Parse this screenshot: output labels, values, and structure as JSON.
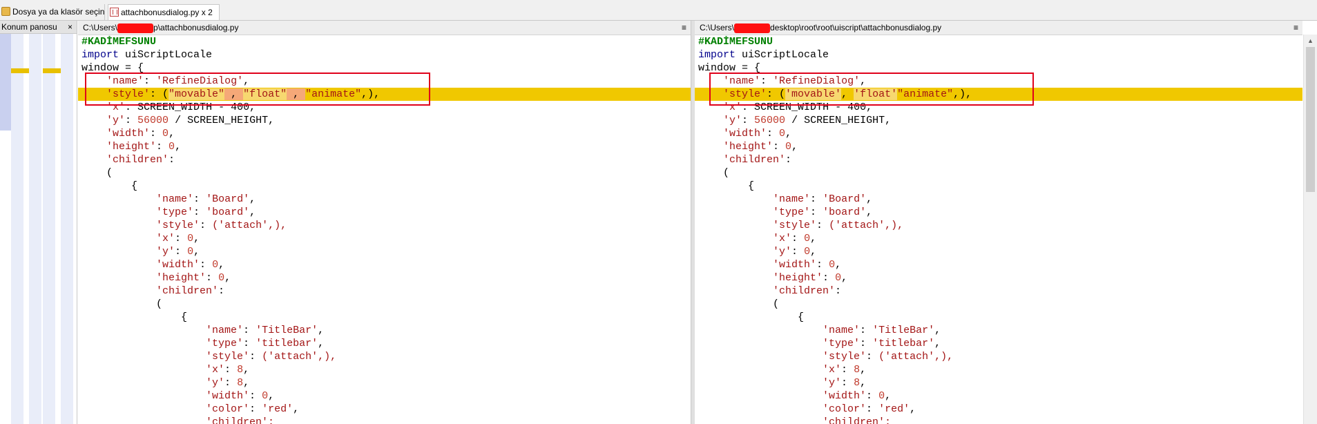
{
  "tabs": [
    {
      "label": "Dosya ya da klasör seçin",
      "icon": "folder-icon"
    },
    {
      "label": "attachbonusdialog.py x 2",
      "icon": "compare-icon"
    }
  ],
  "left_panel": {
    "title": "Konum panosu",
    "close": "×"
  },
  "panes": {
    "left": {
      "path_prefix": "C:\\Users\\",
      "path_suffix": "p\\attachbonusdialog.py",
      "menu": "≡"
    },
    "right": {
      "path_prefix": "C:\\Users\\",
      "path_suffix": "desktop\\root\\root\\uiscript\\attachbonusdialog.py",
      "menu": "≡"
    }
  },
  "code": {
    "comment": "#KADİMEFSUNU",
    "import_kw": "import",
    "import_mod": " uiScriptLocale",
    "window": "window = {",
    "name_key": "'name'",
    "name_val": "'RefineDialog'",
    "style_key": "'style'",
    "style_movable_left": "\"movable\"",
    "style_float_left": "\"float\"",
    "style_animate": "\"animate\"",
    "style_movable_right": "'movable'",
    "style_float_right": "'float'",
    "x_key": "'x'",
    "x_val": "SCREEN_WIDTH - 400,",
    "y_key": "'y'",
    "y_num": "56000",
    "y_rest": " / SCREEN_HEIGHT,",
    "width_key": "'width'",
    "height_key": "'height'",
    "children_key": "'children'",
    "zero": "0",
    "eight": "8",
    "open_paren": "(",
    "open_brace": "{",
    "board_name": "'Board'",
    "board_type_key": "'type'",
    "board_type": "'board'",
    "attach": "('attach',),",
    "titlebar_name": "'TitleBar'",
    "titlebar_type": "'titlebar'",
    "color_key": "'color'",
    "color_val": "'red'",
    "last_line": "'children':"
  }
}
